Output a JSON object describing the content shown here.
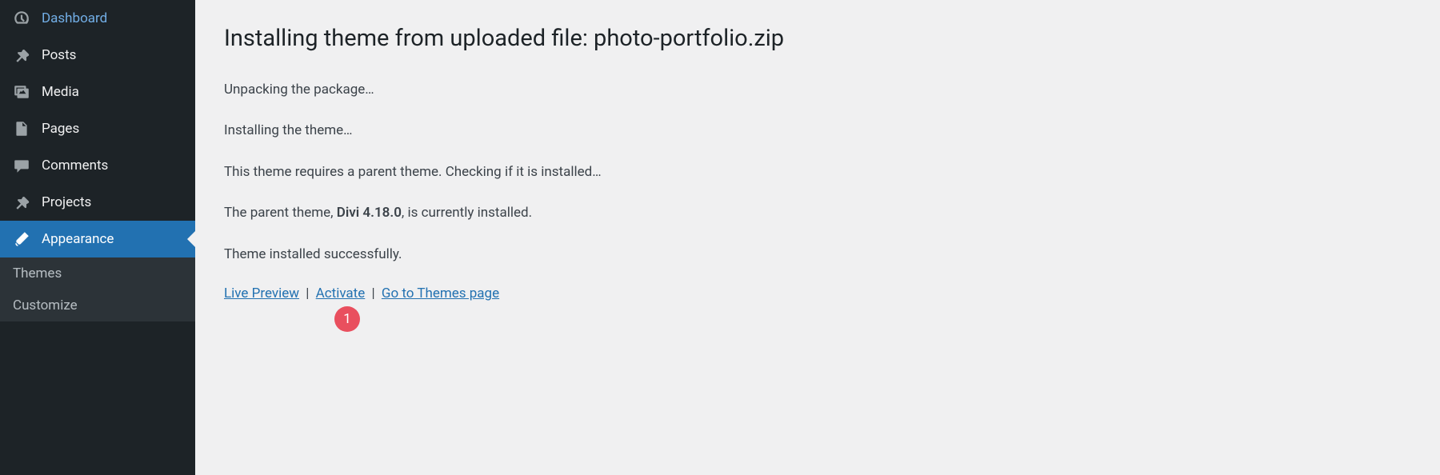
{
  "sidebar": {
    "items": [
      {
        "label": "Dashboard"
      },
      {
        "label": "Posts"
      },
      {
        "label": "Media"
      },
      {
        "label": "Pages"
      },
      {
        "label": "Comments"
      },
      {
        "label": "Projects"
      },
      {
        "label": "Appearance"
      }
    ],
    "subitems": [
      {
        "label": "Themes"
      },
      {
        "label": "Customize"
      }
    ]
  },
  "main": {
    "title": "Installing theme from uploaded file: photo-portfolio.zip",
    "status": {
      "unpacking": "Unpacking the package…",
      "installing": "Installing the theme…",
      "parent_check": "This theme requires a parent theme. Checking if it is installed…",
      "parent_prefix": "The parent theme, ",
      "parent_name": "Divi 4.18.0",
      "parent_suffix": ", is currently installed.",
      "success": "Theme installed successfully."
    },
    "actions": {
      "live_preview": "Live Preview",
      "activate": "Activate",
      "themes_page": "Go to Themes page",
      "separator": "|"
    },
    "annotation": "1"
  }
}
